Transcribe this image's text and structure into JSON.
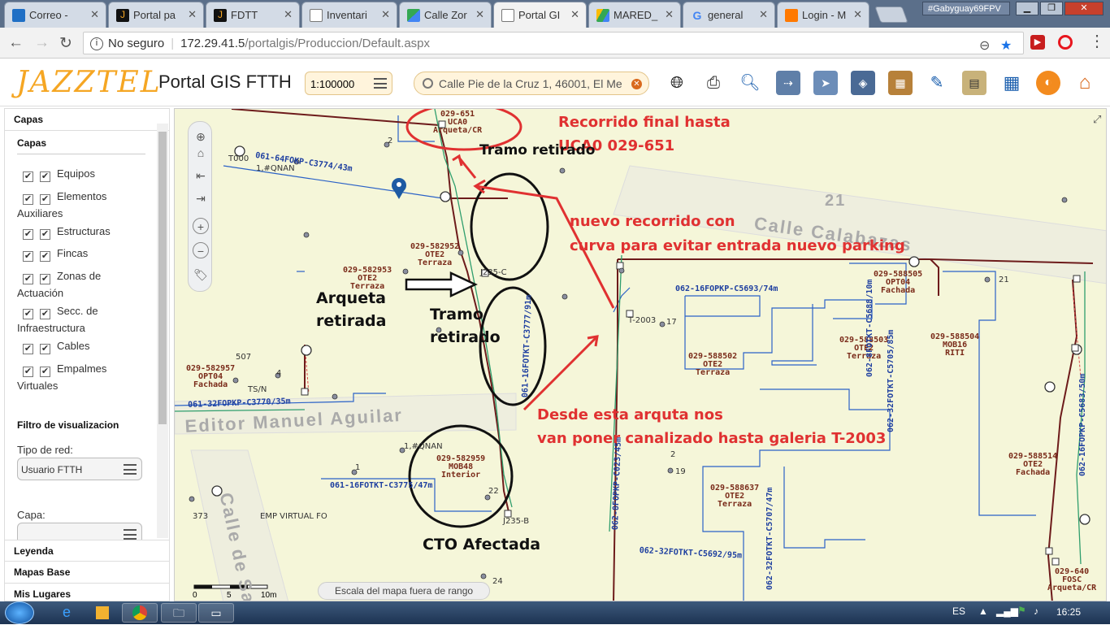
{
  "browser": {
    "tabs": [
      {
        "label": "Correo -",
        "icon": "outlook-icon"
      },
      {
        "label": "Portal pa",
        "icon": "jazztel-icon"
      },
      {
        "label": "FDTT",
        "icon": "jazztel-icon"
      },
      {
        "label": "Inventari",
        "icon": "page-icon"
      },
      {
        "label": "Calle Zor",
        "icon": "maps-icon"
      },
      {
        "label": "Portal GI",
        "icon": "page-icon"
      },
      {
        "label": "MARED_",
        "icon": "drive-icon"
      },
      {
        "label": "general",
        "icon": "google-icon"
      },
      {
        "label": "Login - M",
        "icon": "orange-icon"
      }
    ],
    "user_badge": "#Gabyguay69FPV",
    "security": "No seguro",
    "url_host": "172.29.41.5",
    "url_path": "/portalgis/Produccion/Default.aspx"
  },
  "app": {
    "logo": "JAZZTEL",
    "title": "Portal GIS FTTH",
    "scale": "1:100000",
    "search_value": "Calle Pie de la Cruz 1, 46001, El Me",
    "tools": [
      "globe-icon",
      "print-icon",
      "zoom-icon",
      "measure-icon",
      "route-icon",
      "layers-icon",
      "building-icon",
      "edit-icon",
      "grid-icon",
      "table-icon",
      "jazztel-swirl-icon",
      "home-icon"
    ]
  },
  "left_panel": {
    "header_capas": "Capas",
    "section_capas": "Capas",
    "layers": [
      {
        "label": "Equipos",
        "checked": true
      },
      {
        "label": "Elementos",
        "checked": true
      },
      {
        "label": "Estructuras",
        "checked": true
      },
      {
        "label": "Fincas",
        "checked": true
      },
      {
        "label": "Zonas de",
        "checked": true
      },
      {
        "label": "Secc. de",
        "checked": true
      },
      {
        "label": "Cables",
        "checked": true
      },
      {
        "label": "Empalmes",
        "checked": true
      }
    ],
    "wrap_auxiliares": "Auxiliares",
    "wrap_actuacion": "Actuación",
    "wrap_infra": "Infraestructura",
    "wrap_virtuales": "Virtuales",
    "filter_title": "Filtro de visualizacion",
    "network_type_label": "Tipo de red:",
    "network_type_value": "Usuario FTTH",
    "capa_label": "Capa:",
    "capa_value": "",
    "leyenda": "Leyenda",
    "mapas_base": "Mapas Base",
    "mis_lugares": "Mis Lugares"
  },
  "map": {
    "scale_message": "Escala del mapa fuera de rango",
    "scalebar": [
      "0",
      "5",
      "10m"
    ],
    "street_names": [
      "Calle Calabazas",
      "Editor Manuel Aguilar",
      "Calle de Sa"
    ],
    "street_number": "21",
    "labels": [
      {
        "id": "029-651",
        "l2": "UCA0",
        "l3": "Arqueta/CR"
      },
      {
        "id": "029-582952",
        "l2": "OTE2",
        "l3": "Terraza"
      },
      {
        "id": "029-582953",
        "l2": "OTE2",
        "l3": "Terraza"
      },
      {
        "id": "029-582957",
        "l2": "OPT04",
        "l3": "Fachada"
      },
      {
        "id": "029-582959",
        "l2": "MOB48",
        "l3": "Interior"
      },
      {
        "id": "029-588505",
        "l2": "OPT04",
        "l3": "Fachada"
      },
      {
        "id": "029-588503",
        "l2": "OTE2",
        "l3": "Terraza"
      },
      {
        "id": "029-588502",
        "l2": "OTE2",
        "l3": "Terraza"
      },
      {
        "id": "029-588504",
        "l2": "MOB16",
        "l3": "RITI"
      },
      {
        "id": "029-588637",
        "l2": "OTE2",
        "l3": "Terraza"
      },
      {
        "id": "029-588514",
        "l2": "OTE2",
        "l3": "Fachada"
      },
      {
        "id": "029-640",
        "l2": "FOSC",
        "l3": "Arqueta/CR"
      }
    ],
    "cables": [
      "061-64FOKP-C3774/43m",
      "062-16FOPKP-C5693/74m",
      "061-32FOPKP-C3770/35m",
      "061-16FOTKT-C3775/47m",
      "062-32FOTKT-C5692/95m",
      "061-16FOTKT-C3777/91m",
      "062-8FOPKP-C023/45m",
      "062-32FOTKT-C5705/85m",
      "062-32FOTKT-C5707/47m",
      "062-8FOTKT-C5688/10m",
      "062-16FOPKP-C5683/50m"
    ],
    "small_labels": [
      "T000",
      "1,#QNAN",
      "2",
      "J235-C",
      "T-2003",
      "17",
      "507",
      "4",
      "TS/N",
      "1",
      "J235-B",
      "22",
      "24",
      "373",
      "EMP VIRTUAL FO",
      "19",
      "21",
      "1,#QNAN",
      "2"
    ],
    "annotations_red": [
      "Recorrido final hasta",
      "UCA0 029-651",
      "nuevo recorrido con",
      "curva para evitar entrada nuevo parking",
      "Desde esta arquta nos",
      "van poner canalizado hasta galeria T-2003"
    ],
    "annotations_black": [
      "Tramo retirado",
      "Arqueta",
      "retirada",
      "Tramo",
      "retirado",
      "CTO Afectada"
    ]
  },
  "taskbar": {
    "lang": "ES",
    "time": "16:25"
  },
  "colors": {
    "map_bg": "#f5f6d9",
    "cable_red": "#8b1a1a",
    "cable_blue": "#2b62c7",
    "annotation_red": "#e03131",
    "accent_orange": "#f5a623"
  }
}
